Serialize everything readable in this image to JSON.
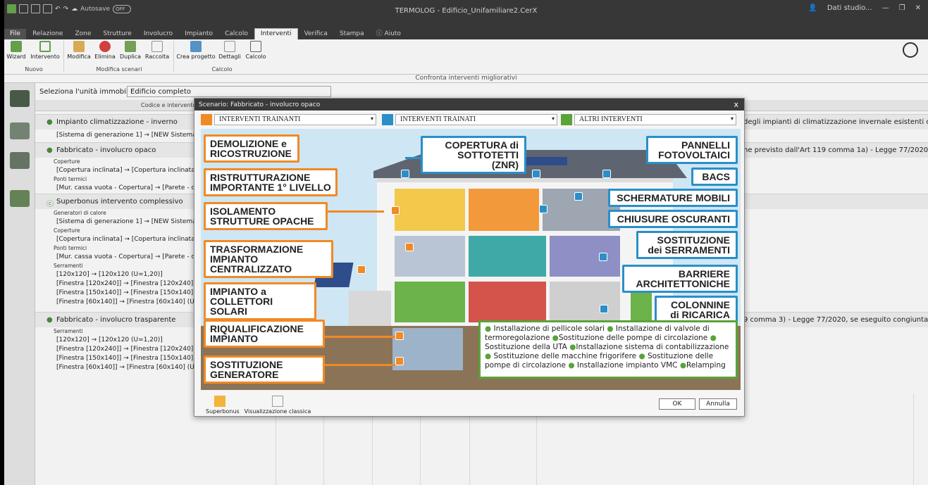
{
  "window": {
    "title": "TERMOLOG - Edificio_Unifamiliare2.CerX",
    "autosave_label": "Autosave",
    "autosave_state": "OFF",
    "user_label": "Dati studio..."
  },
  "menu_tabs": [
    "File",
    "Relazione",
    "Zone",
    "Strutture",
    "Involucro",
    "Impianto",
    "Calcolo",
    "Interventi",
    "Verifica",
    "Stampa",
    "Aiuto"
  ],
  "active_tab": "Interventi",
  "ribbon": {
    "buttons": [
      "Wizard",
      "Intervento",
      "Modifica",
      "Elimina",
      "Duplica",
      "Raccolta",
      "Crea progetto",
      "Dettagli",
      "Calcolo"
    ],
    "groups": [
      "Nuovo",
      "Modifica scenari",
      "Calcolo"
    ]
  },
  "compare_bar": "Confronta interventi migliorativi",
  "unit_select": {
    "label": "Seleziona l'unità immobiliare",
    "value": "Edificio completo"
  },
  "table_header": "Codice e intervento",
  "tree": {
    "r1": "Impianto climatizzazione - inverno",
    "r1_right": "degli impianti di climatizzazione invernale esistenti con i...",
    "r1a": "[Sistema di generazione 1] → [NEW Sistema",
    "r2": "Fabbricato - involucro opaco",
    "r2_right": "ne previsto dall'Art 119 comma 1a) - Legge 77/2020. L'is...",
    "c_coperture": "Coperture",
    "r2a": "[Copertura inclinata] → [Copertura inclinata",
    "c_ponti": "Ponti termici",
    "r2b": "[Mur. cassa vuota - Copertura] → [Parete - c",
    "r3": "Superbonus intervento complessivo",
    "c_gen": "Generatori di calore",
    "r3a": "[Sistema di generazione 1] → [NEW Sistema",
    "c_coperture2": "Coperture",
    "r3b": "[Copertura inclinata] → [Copertura inclinata",
    "c_ponti2": "Ponti termici",
    "r3c": "[Mur. cassa vuota - Copertura] → [Parete - c",
    "c_serr": "Serramenti",
    "r3d": "[120x120] → [120x120 (U=1,20)]",
    "r3e": "[Finestra [120x240]] → [Finestra [120x240] (",
    "r3f": "[Finestra [150x140]] → [Finestra [150x140] (",
    "r3g": "[Finestra [60x140]] → [Finestra [60x140] (U=",
    "r4": "Fabbricato - involucro trasparente",
    "r4_right": "9 comma 3) - Legge 77/2020, se eseguito congiuntamen...",
    "c_serr2": "Serramenti",
    "r4a": "[120x120] → [120x120 (U=1,20)]",
    "r4b": "[Finestra [120x240]] → [Finestra [120x240] (",
    "r4c": "[Finestra [150x140]] → [Finestra [150x140] (",
    "r4d": "[Finestra [60x140]] → [Finestra [60x140] (U="
  },
  "dialog": {
    "title": "Scenario: Fabbricato - involucro opaco",
    "close": "x",
    "dropdowns": [
      "INTERVENTI TRAINANTI",
      "INTERVENTI TRAINATI",
      "ALTRI INTERVENTI"
    ],
    "orange_labels": [
      "DEMOLIZIONE e RICOSTRUZIONE",
      "RISTRUTTURAZIONE IMPORTANTE 1° LIVELLO",
      "ISOLAMENTO STRUTTURE OPACHE",
      "TRASFORMAZIONE IMPIANTO CENTRALIZZATO",
      "IMPIANTO a COLLETTORI SOLARI",
      "RIQUALIFICAZIONE IMPIANTO",
      "SOSTITUZIONE GENERATORE"
    ],
    "blue_labels": {
      "copertura": "COPERTURA di",
      "copertura2": "SOTTOTETTI (ZNR)",
      "pannelli": "PANNELLI",
      "pannelli2": "FOTOVOLTAICI",
      "bacs": "BACS",
      "schermature": "SCHERMATURE MOBILI",
      "chiusure": "CHIUSURE OSCURANTI",
      "serramenti": "SOSTITUZIONE",
      "serramenti2": "dei SERRAMENTI",
      "barriere": "BARRIERE",
      "barriere2": "ARCHITETTONICHE",
      "colonnine": "COLONNINE",
      "colonnine2": "di RICARICA"
    },
    "green_box": {
      "l1": "Installazione di pellicole solari",
      "l2": "Installazione di valvole di",
      "l3": "termoregolazione",
      "l4": "Sostituzione delle pompe di circolazione",
      "l5": "Sostituzione della UTA",
      "l6": "Installazione sistema di contabilizzazione",
      "l7": "Sostituzione delle macchine frigorifere",
      "l8": "Sostituzione delle pompe di",
      "l9": "circolazione",
      "l10": "Installazione impianto VMC",
      "l11": "Relamping"
    },
    "footer": {
      "superbonus": "Superbonus",
      "classic": "Visualizzazione classica",
      "ok": "OK",
      "cancel": "Annulla"
    }
  },
  "colors": {
    "orange": "#f08a24",
    "blue": "#2a8fc9",
    "green": "#5aa33b"
  }
}
